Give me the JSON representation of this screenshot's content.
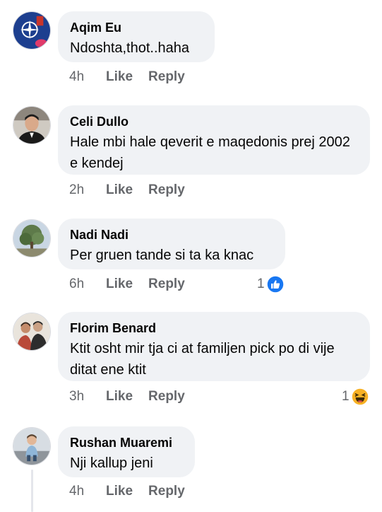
{
  "comments": [
    {
      "author": "Aqim Eu",
      "text": "Ndoshta,thot..haha",
      "time": "4h",
      "like": "Like",
      "reply": "Reply",
      "avatar_icon": "nato-flag-avatar"
    },
    {
      "author": "Celi Dullo",
      "text": "Hale mbi hale qeverit e maqedonis prej 2002 e kendej",
      "time": "2h",
      "like": "Like",
      "reply": "Reply",
      "avatar_icon": "man-portrait-avatar"
    },
    {
      "author": "Nadi Nadi",
      "text": "Per gruen tande si ta ka knac",
      "time": "6h",
      "like": "Like",
      "reply": "Reply",
      "reaction_count": "1",
      "reaction_icon": "like-reaction-icon",
      "avatar_icon": "tree-photo-avatar"
    },
    {
      "author": "Florim Benard",
      "text": "Ktit osht mir tja ci at familjen pick po di vije ditat ene ktit",
      "time": "3h",
      "like": "Like",
      "reply": "Reply",
      "reaction_count": "1",
      "reaction_icon": "haha-reaction-icon",
      "avatar_icon": "couple-photo-avatar"
    },
    {
      "author": "Rushan Muaremi",
      "text": "Nji kallup jeni",
      "time": "4h",
      "like": "Like",
      "reply": "Reply",
      "avatar_icon": "child-photo-avatar"
    }
  ],
  "colors": {
    "bubble": "#f0f2f5",
    "meta_text": "#65676b",
    "like_blue": "#1877f2",
    "haha_yellow": "#f7b125"
  }
}
